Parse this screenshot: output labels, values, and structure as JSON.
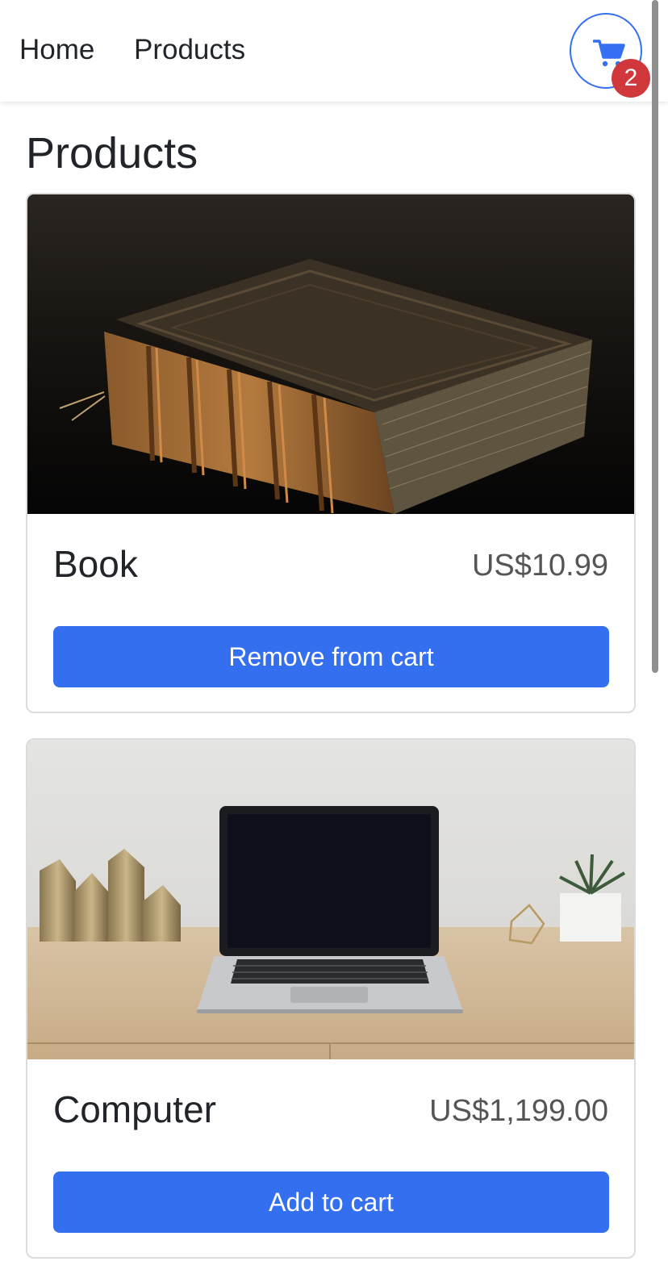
{
  "nav": {
    "links": [
      {
        "label": "Home"
      },
      {
        "label": "Products"
      }
    ],
    "cart": {
      "icon": "shopping-cart-icon",
      "count": "2",
      "accent": "#3570f2",
      "badge_color": "#d0383c"
    }
  },
  "page": {
    "title": "Products"
  },
  "products": [
    {
      "name": "Book",
      "price": "US$10.99",
      "action_label": "Remove from cart",
      "image": "antique-book-photo"
    },
    {
      "name": "Computer",
      "price": "US$1,199.00",
      "action_label": "Add to cart",
      "image": "laptop-on-desk-photo"
    }
  ],
  "colors": {
    "button": "#346ff0",
    "text": "#212529",
    "price_text": "#555555"
  }
}
